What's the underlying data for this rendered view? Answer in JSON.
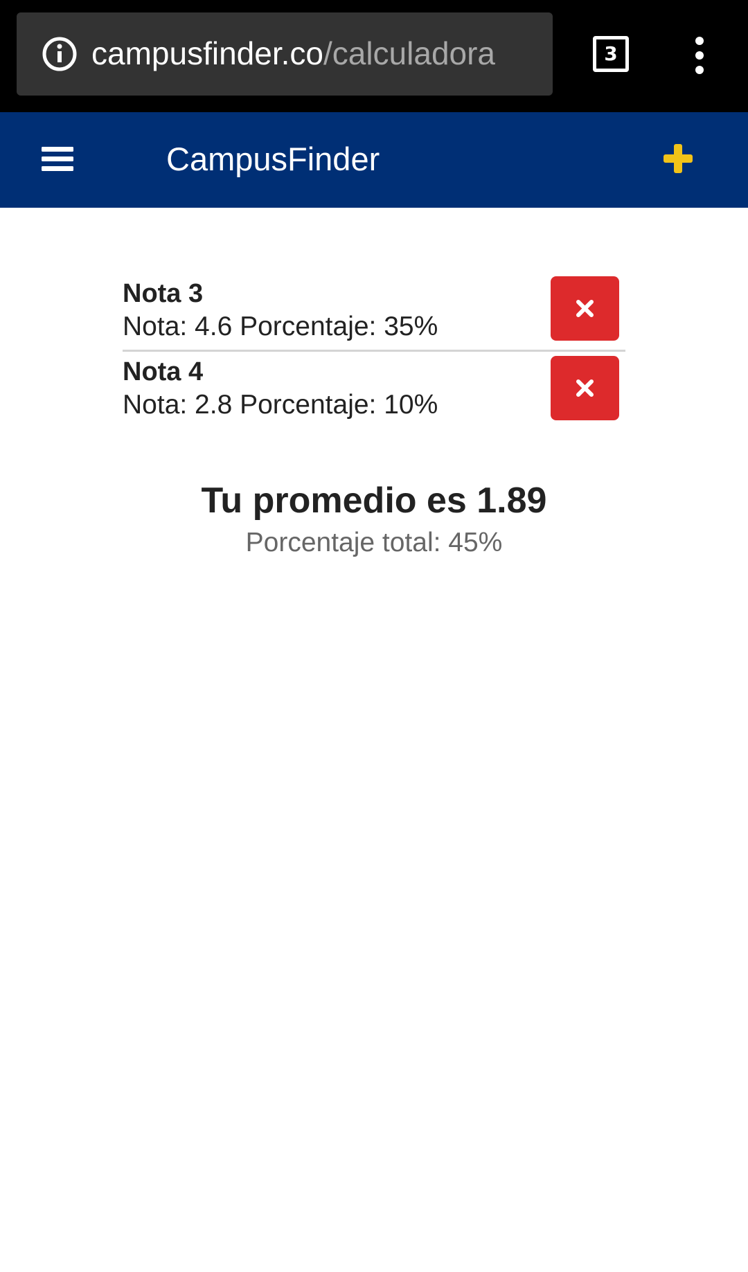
{
  "browser": {
    "url_domain": "campusfinder.co",
    "url_path": "/calculadora",
    "tab_count": "3",
    "icons": [
      "info-icon",
      "tabs-count-icon",
      "more-vert-icon"
    ]
  },
  "header": {
    "title": "CampusFinder",
    "icons": [
      "menu-icon",
      "plus-icon"
    ],
    "background_color": "#002f75",
    "accent_color": "#f2c318"
  },
  "grades": [
    {
      "title": "Nota 3",
      "detail": "Nota: 4.6 Porcentaje: 35%"
    },
    {
      "title": "Nota 4",
      "detail": "Nota: 2.8 Porcentaje: 10%"
    }
  ],
  "delete_button_color": "#dd2a2c",
  "summary": {
    "average": "Tu promedio es 1.89",
    "total": "Porcentaje total: 45%"
  }
}
